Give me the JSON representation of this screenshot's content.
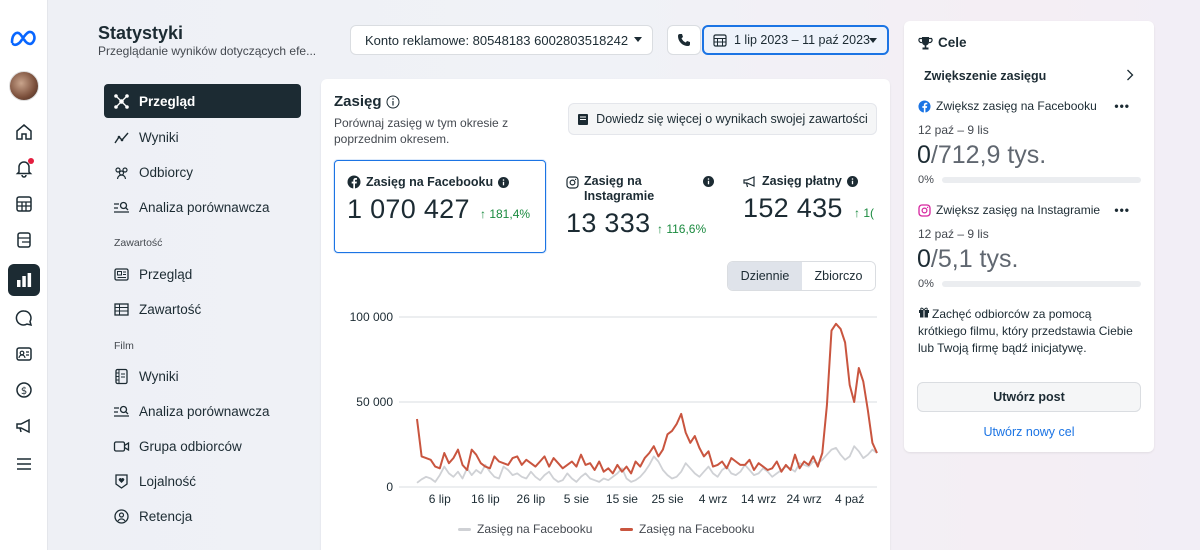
{
  "header": {
    "title": "Statystyki",
    "subtitle": "Przeglądanie wyników dotyczących efe...",
    "account_label": "Konto reklamowe: 80548183 6002803518242",
    "date_range": "1 lip 2023 – 11 paź 2023"
  },
  "sidebar": {
    "items": [
      {
        "label": "Przegląd",
        "icon": "overview-icon",
        "active": true
      },
      {
        "label": "Wyniki",
        "icon": "results-icon"
      },
      {
        "label": "Odbiorcy",
        "icon": "audience-icon"
      },
      {
        "label": "Analiza porównawcza",
        "icon": "benchmark-icon"
      }
    ],
    "content_section": "Zawartość",
    "content_items": [
      {
        "label": "Przegląd",
        "icon": "content-overview-icon"
      },
      {
        "label": "Zawartość",
        "icon": "content-table-icon"
      }
    ],
    "film_section": "Film",
    "film_items": [
      {
        "label": "Wyniki",
        "icon": "film-results-icon"
      },
      {
        "label": "Analiza porównawcza",
        "icon": "film-benchmark-icon"
      },
      {
        "label": "Grupa odbiorców",
        "icon": "video-audience-icon"
      },
      {
        "label": "Lojalność",
        "icon": "loyalty-icon"
      },
      {
        "label": "Retencja",
        "icon": "retention-icon"
      }
    ]
  },
  "reach": {
    "title": "Zasięg",
    "description": "Porównaj zasięg w tym okresie z poprzednim okresem.",
    "learn_more": "Dowiedz się więcej o wynikach swojej zawartości",
    "metrics": [
      {
        "label": "Zasięg na Facebooku",
        "value": "1 070 427",
        "delta": "↑ 181,4%",
        "icon": "facebook-icon"
      },
      {
        "label": "Zasięg na Instagramie",
        "value": "13 333",
        "delta": "↑ 116,6%",
        "icon": "instagram-icon"
      },
      {
        "label": "Zasięg płatny",
        "value": "152 435",
        "delta": "↑ 1(",
        "icon": "megaphone-icon"
      }
    ],
    "toggle": {
      "daily": "Dziennie",
      "cumulative": "Zbiorczo"
    },
    "legend": [
      "Zasięg na Facebooku",
      "Zasięg na Facebooku"
    ]
  },
  "chart_data": {
    "type": "line",
    "x_ticks": [
      "6 lip",
      "16 lip",
      "26 lip",
      "5 sie",
      "15 sie",
      "25 sie",
      "4 wrz",
      "14 wrz",
      "24 wrz",
      "4 paź"
    ],
    "y_ticks": [
      "100 000",
      "50 000",
      "0"
    ],
    "ylim": [
      0,
      100000
    ],
    "x_start": "1 lip 2023",
    "x_step_days": 1,
    "series": [
      {
        "name": "Zasięg na Facebooku",
        "color": "#cfd1d5",
        "values": [
          2500,
          4500,
          6000,
          5000,
          3000,
          7000,
          12000,
          8000,
          6000,
          9000,
          5000,
          11000,
          7000,
          10000,
          8000,
          13000,
          9000,
          6000,
          5000,
          12000,
          10000,
          7000,
          8000,
          6000,
          5000,
          9000,
          6000,
          4000,
          7000,
          9000,
          5000,
          3000,
          4000,
          8000,
          5000,
          3000,
          6000,
          8000,
          5000,
          4000,
          3000,
          5000,
          4000,
          6000,
          8000,
          11000,
          5000,
          3000,
          4000,
          6000,
          9000,
          13000,
          18000,
          15000,
          10000,
          7000,
          5000,
          6000,
          9000,
          14000,
          11000,
          8000,
          6000,
          9000,
          12000,
          8000,
          6000,
          10000,
          12000,
          8000,
          7000,
          9000,
          13000,
          10000,
          7000,
          8000,
          11000,
          9000,
          6000,
          8000,
          10000,
          12000,
          11000,
          9000,
          14000,
          13000,
          12000,
          15000,
          14000,
          16000,
          19000,
          22000,
          23000,
          19000,
          16000,
          18000,
          24000,
          21000,
          17000,
          19000,
          22000,
          20000
        ]
      },
      {
        "name": "Zasięg na Facebooku",
        "color": "#c9553f",
        "values": [
          40000,
          18000,
          17000,
          16000,
          12000,
          11000,
          20000,
          14000,
          17000,
          22000,
          13000,
          10000,
          22000,
          19000,
          14000,
          12000,
          11000,
          18000,
          15000,
          14000,
          13000,
          17000,
          18000,
          13000,
          16000,
          14000,
          12000,
          15000,
          18000,
          12000,
          17000,
          14000,
          11000,
          13000,
          15000,
          12000,
          19000,
          13000,
          14000,
          10000,
          15000,
          9000,
          11000,
          8000,
          13000,
          9000,
          12000,
          8000,
          15000,
          12000,
          17000,
          20000,
          24000,
          18000,
          22000,
          31000,
          33000,
          37000,
          43000,
          32000,
          26000,
          30000,
          23000,
          18000,
          21000,
          12000,
          13000,
          15000,
          11000,
          17000,
          15000,
          13000,
          13000,
          16000,
          10000,
          14000,
          12000,
          10000,
          11000,
          15000,
          9000,
          13000,
          10000,
          19000,
          11000,
          15000,
          13000,
          18000,
          12000,
          20000,
          48000,
          92000,
          96000,
          93000,
          85000,
          60000,
          50000,
          70000,
          62000,
          45000,
          26000,
          20000
        ]
      }
    ]
  },
  "goals": {
    "title": "Cele",
    "section": "Zwiększenie zasięgu",
    "items": [
      {
        "title": "Zwiększ zasięg na Facebooku",
        "icon": "facebook-icon",
        "dates": "12 paź – 9 lis",
        "current": "0",
        "target": "/712,9 tys.",
        "pct_label": "0%",
        "progress": 0
      },
      {
        "title": "Zwiększ zasięg na Instagramie",
        "icon": "instagram-icon",
        "dates": "12 paź – 9 lis",
        "current": "0",
        "target": "/5,1 tys.",
        "pct_label": "0%",
        "progress": 0
      }
    ],
    "more": "•••",
    "tip": "Zachęć odbiorców za pomocą krótkiego filmu, który przedstawia Ciebie lub Twoją firmę bądź inicjatywę.",
    "create_post": "Utwórz post",
    "new_goal": "Utwórz nowy cel"
  },
  "colors": {
    "accent": "#1b74e4",
    "nav_active": "#1c2b33",
    "positive": "#1a8a3f",
    "series_paid": "#c9553f",
    "series_gray": "#cfd1d5"
  }
}
